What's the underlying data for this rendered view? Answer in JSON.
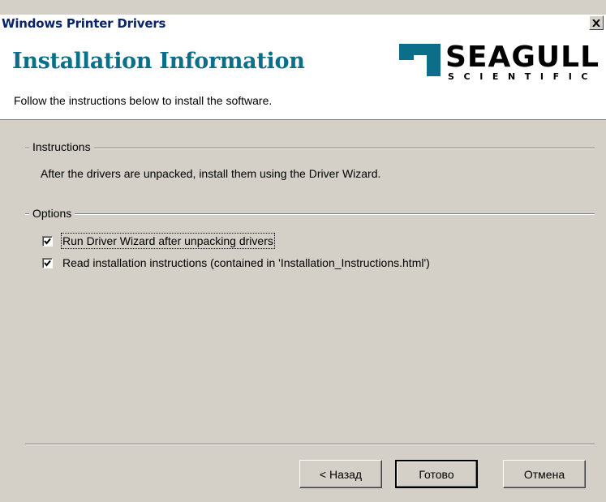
{
  "window": {
    "title": "Windows Printer Drivers"
  },
  "header": {
    "title": "Installation Information",
    "subtitle": "Follow the instructions below to install the software.",
    "logo": {
      "name": "SEAGULL",
      "sub": "SCIENTIFIC",
      "icon": "seagull-logo-icon"
    }
  },
  "instructions": {
    "label": "Instructions",
    "text": "After the drivers are unpacked, install them using the Driver Wizard."
  },
  "options": {
    "label": "Options",
    "items": [
      {
        "label": "Run Driver Wizard after unpacking drivers",
        "checked": true
      },
      {
        "label": "Read installation instructions (contained in 'Installation_Instructions.html')",
        "checked": true
      }
    ]
  },
  "buttons": {
    "back": "< Назад",
    "finish": "Готово",
    "cancel": "Отмена"
  },
  "colors": {
    "title_text": "#0a246a",
    "header_title": "#0c6f8a",
    "dialog_bg": "#d4d0c8"
  }
}
